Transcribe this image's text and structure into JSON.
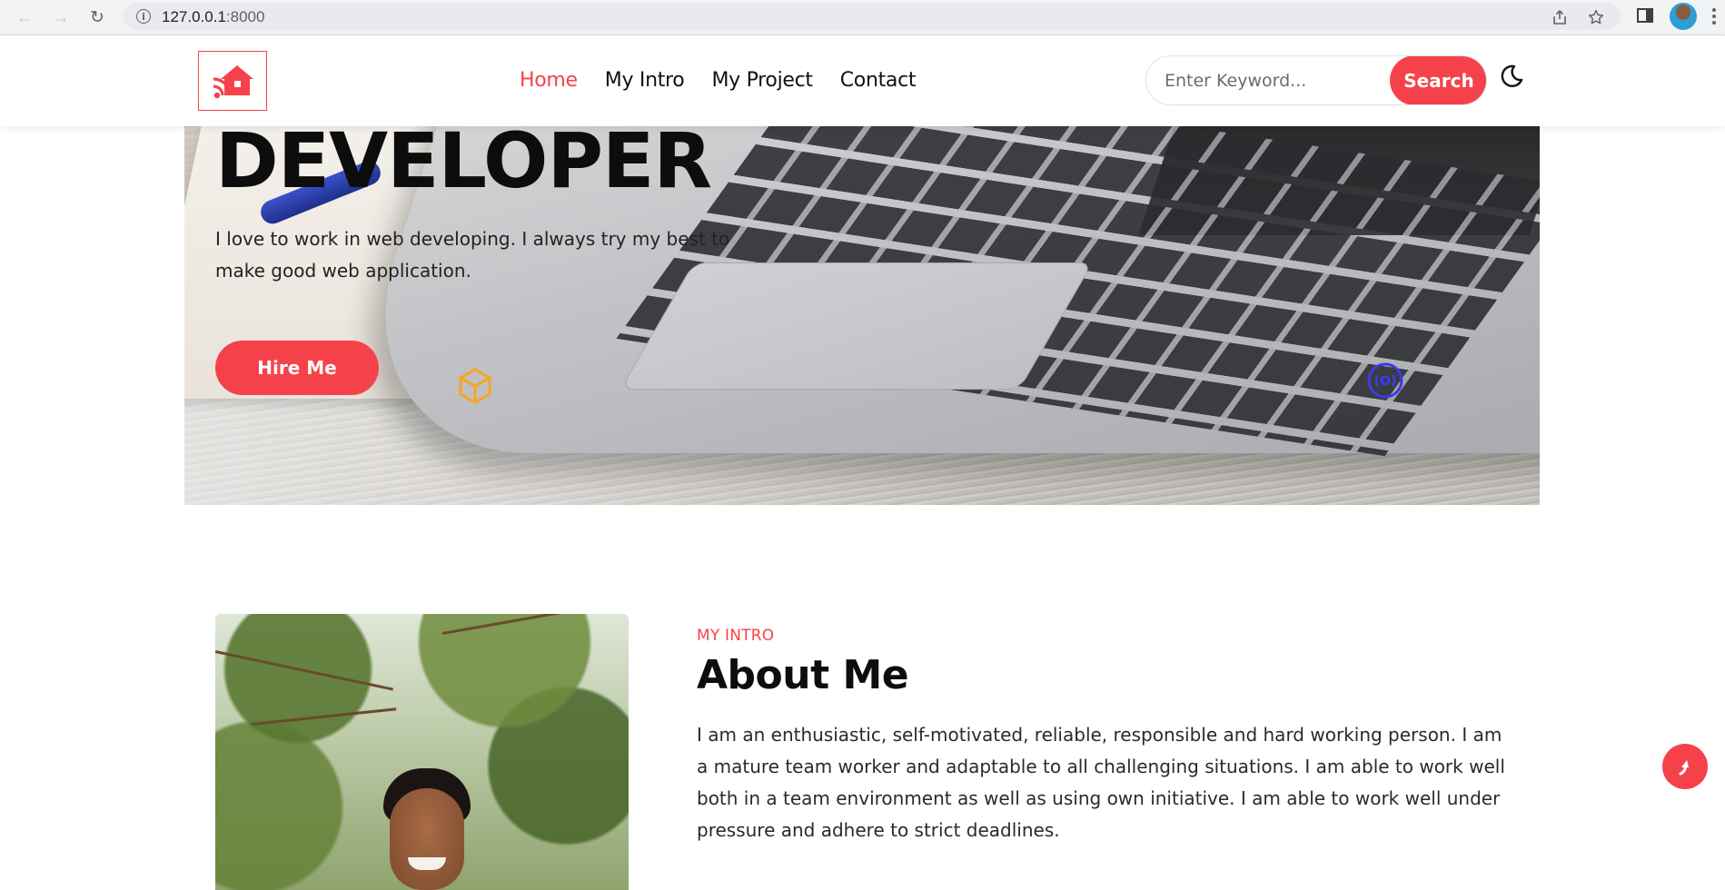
{
  "browser": {
    "url_host": "127.0.0.1",
    "url_port": ":8000",
    "icons": [
      "back-arrow-icon",
      "forward-arrow-icon",
      "reload-icon",
      "info-icon",
      "share-icon",
      "star-icon",
      "side-panel-icon",
      "profile-avatar",
      "menu-icon"
    ]
  },
  "header": {
    "logo_icon": "house-wifi-icon",
    "nav": [
      {
        "label": "Home",
        "active": true
      },
      {
        "label": "My Intro",
        "active": false
      },
      {
        "label": "My Project",
        "active": false
      },
      {
        "label": "Contact",
        "active": false
      }
    ],
    "search": {
      "placeholder": "Enter Keyword...",
      "value": "",
      "button_label": "Search"
    },
    "theme_icon": "moon-icon"
  },
  "hero": {
    "title": "DEVELOPER",
    "description": "I love to work in web developing. I always try my best to make good web application.",
    "cta_label": "Hire Me",
    "decor_icons": [
      "cube-icon",
      "disc-icon"
    ]
  },
  "about": {
    "eyebrow": "MY INTRO",
    "title": "About Me",
    "text": "I am an enthusiastic, self-motivated, reliable, responsible and hard working person. I am a mature team worker and adaptable to all challenging situations. I am able to work well both in a team environment as well as using own initiative. I am able to work well under pressure and adhere to strict deadlines."
  },
  "scroll_top_icon": "arrow-up-icon",
  "colors": {
    "accent": "#f5424a",
    "text": "#0d0d0d",
    "cube": "#f5a623",
    "disc": "#3b3be8"
  }
}
